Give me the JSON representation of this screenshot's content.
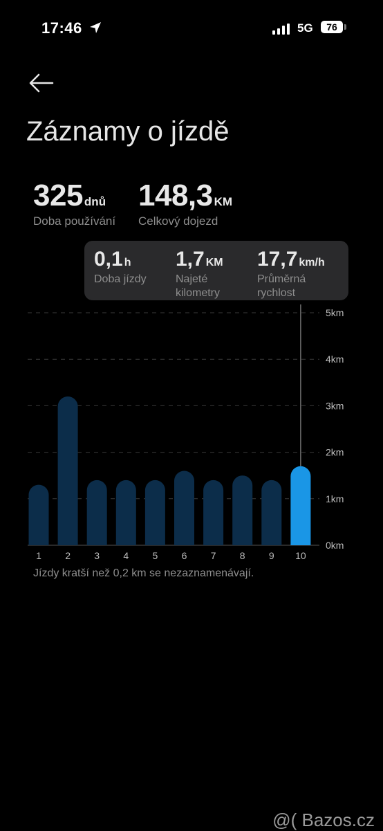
{
  "status_bar": {
    "time": "17:46",
    "network": "5G",
    "battery": "76"
  },
  "page": {
    "title": "Záznamy o jízdě"
  },
  "summary": {
    "usage": {
      "value": "325",
      "unit": "dnů",
      "label": "Doba používání"
    },
    "distance": {
      "value": "148,3",
      "unit": "KM",
      "label": "Celkový dojezd"
    }
  },
  "tooltip": {
    "time": {
      "value": "0,1",
      "unit": "h",
      "label": "Doba jízdy"
    },
    "km": {
      "value": "1,7",
      "unit": "KM",
      "label": "Najeté kilometry"
    },
    "speed": {
      "value": "17,7",
      "unit": "km/h",
      "label": "Průměrná rychlost"
    }
  },
  "chart_data": {
    "type": "bar",
    "categories": [
      "1",
      "2",
      "3",
      "4",
      "5",
      "6",
      "7",
      "8",
      "9",
      "10"
    ],
    "values": [
      1.3,
      3.2,
      1.4,
      1.4,
      1.4,
      1.6,
      1.4,
      1.5,
      1.4,
      1.7
    ],
    "ylim": [
      0,
      5
    ],
    "ytick_labels": [
      "0km",
      "1km",
      "2km",
      "3km",
      "4km",
      "5km"
    ],
    "selected_index": 9,
    "grid": true,
    "colors": {
      "bar": "#0c2d4a",
      "selected": "#1a96e6"
    }
  },
  "note": "Jízdy kratší než 0,2 km se nezaznamenávají.",
  "watermark": "@( Bazos.cz"
}
